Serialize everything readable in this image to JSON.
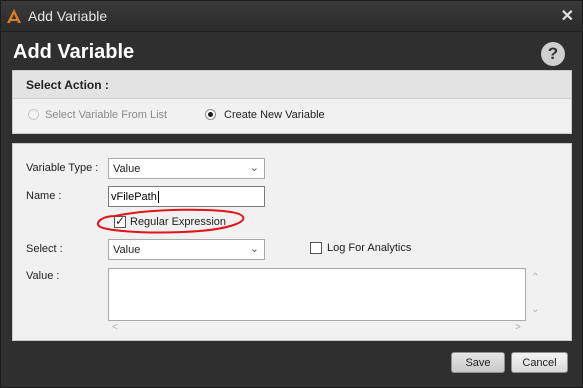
{
  "window": {
    "title": "Add Variable",
    "close_glyph": "✕"
  },
  "dialog": {
    "heading": "Add Variable",
    "help_glyph": "?"
  },
  "select_action": {
    "label": "Select Action :",
    "options": [
      {
        "label": "Select Variable From List",
        "checked": false,
        "enabled": false
      },
      {
        "label": "Create New Variable",
        "checked": true,
        "enabled": true
      }
    ]
  },
  "form": {
    "variable_type": {
      "label": "Variable Type :",
      "value": "Value"
    },
    "name": {
      "label": "Name :",
      "value": "vFilePath"
    },
    "regular_expression": {
      "label": "Regular Expression",
      "checked": true,
      "highlight_color": "#e0141b"
    },
    "select": {
      "label": "Select :",
      "value": "Value"
    },
    "log_for_analytics": {
      "label": "Log For Analytics",
      "checked": false
    },
    "value": {
      "label": "Value :",
      "value": ""
    }
  },
  "buttons": {
    "save": "Save",
    "cancel": "Cancel"
  },
  "icons": {
    "app": "app-logo-icon",
    "dropdown": "chevron-down-icon",
    "scroll_up": "chevron-up-icon",
    "scroll_down": "chevron-down-icon",
    "scroll_left": "chevron-left-icon",
    "scroll_right": "chevron-right-icon"
  }
}
